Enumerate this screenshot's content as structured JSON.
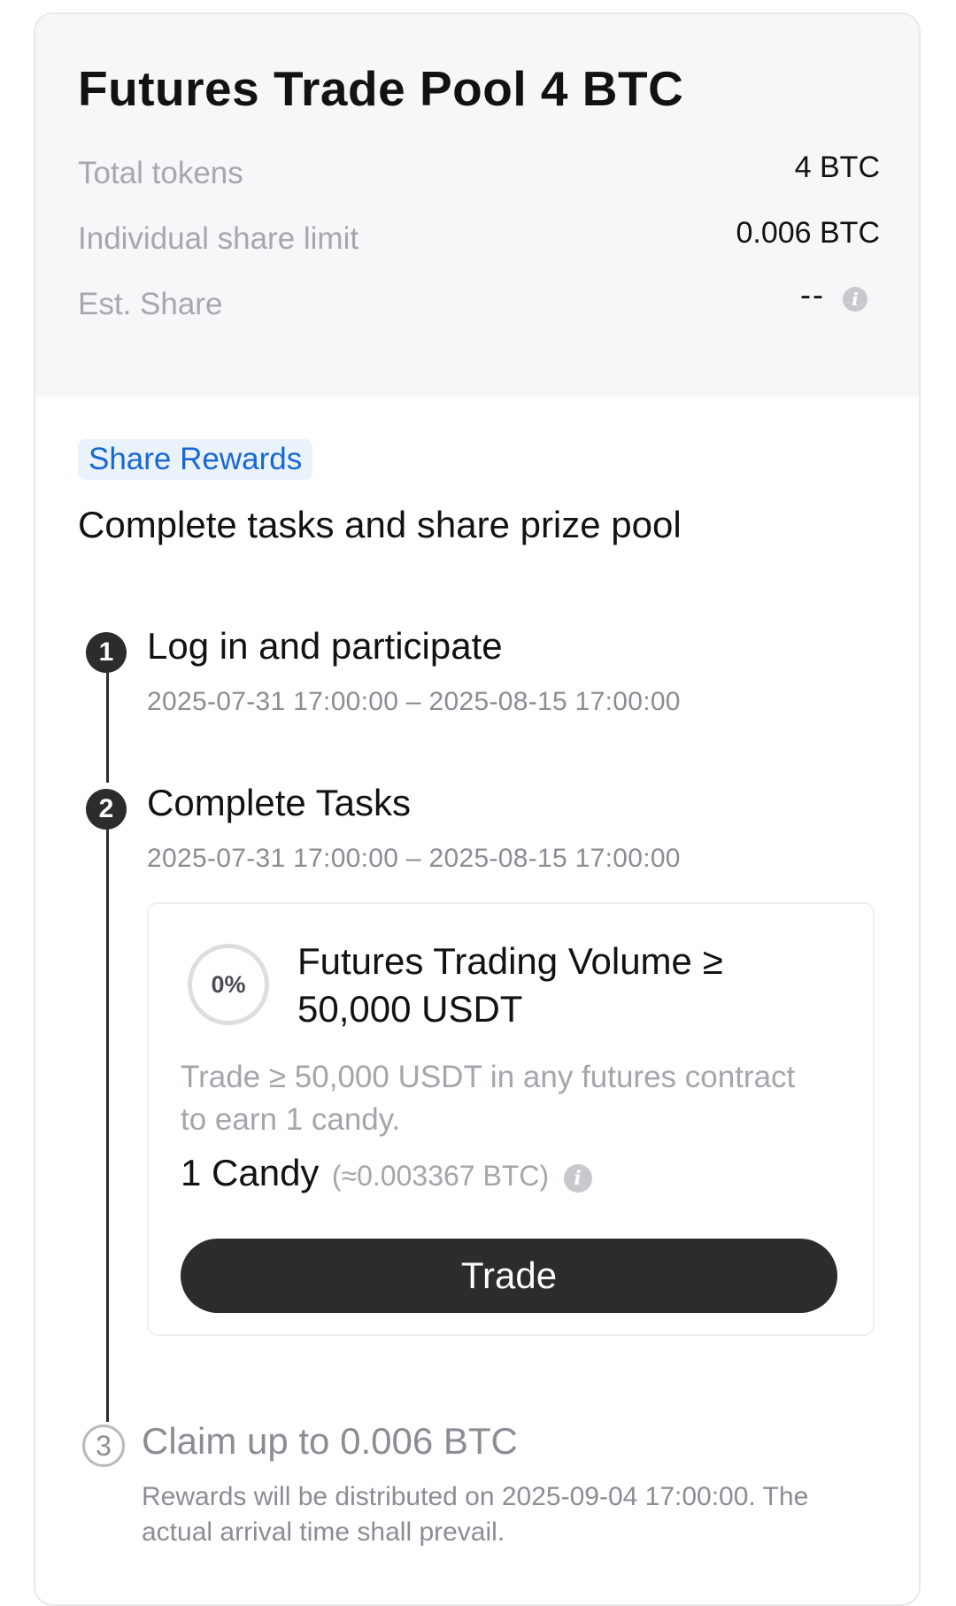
{
  "pool": {
    "title": "Futures Trade Pool 4 BTC",
    "stats": [
      {
        "label": "Total tokens",
        "value": "4 BTC"
      },
      {
        "label": "Individual share limit",
        "value": "0.006 BTC"
      },
      {
        "label": "Est. Share",
        "value": "--"
      }
    ],
    "info_icon": "i"
  },
  "section": {
    "badge": "Share Rewards",
    "subtitle": "Complete tasks and share prize pool"
  },
  "steps": [
    {
      "number": "1",
      "title": "Log in and participate",
      "time": "2025-07-31 17:00:00 – 2025-08-15 17:00:00"
    },
    {
      "number": "2",
      "title": "Complete Tasks",
      "time": "2025-07-31 17:00:00 – 2025-08-15 17:00:00"
    },
    {
      "number": "3",
      "title": "Claim up to 0.006 BTC",
      "time": "Rewards will be distributed on 2025-09-04 17:00:00. The actual arrival time shall prevail."
    }
  ],
  "task": {
    "progress": "0%",
    "progress_fraction": 0,
    "title": "Futures Trading Volume ≥ 50,000 USDT",
    "description": "Trade ≥ 50,000 USDT in any futures contract to earn 1 candy.",
    "reward": "1 Candy",
    "reward_approx": "(≈0.003367 BTC)",
    "button_label": "Trade"
  },
  "colors": {
    "accent": "#1768d6",
    "dark": "#2c2c2e",
    "muted": "#a3a6ab",
    "header_bg": "#f5f7f8"
  }
}
